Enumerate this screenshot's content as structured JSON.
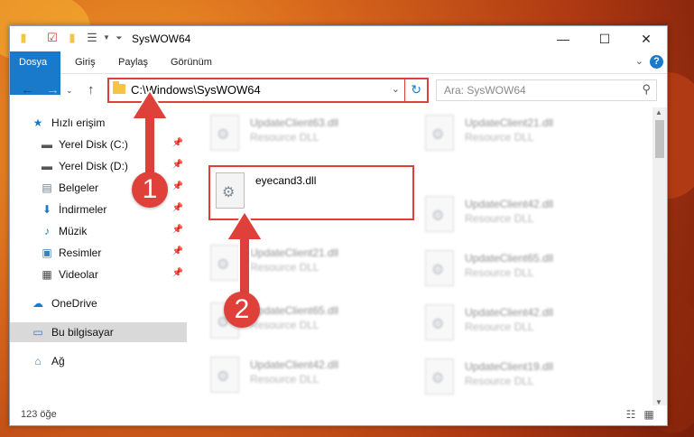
{
  "window": {
    "title": "SysWOW64",
    "controls": {
      "minimize": "—",
      "maximize": "☐",
      "close": "✕"
    }
  },
  "ribbon": {
    "tabs": [
      "Dosya",
      "Giriş",
      "Paylaş",
      "Görünüm"
    ],
    "help": "?"
  },
  "address": {
    "path": "C:\\Windows\\SysWOW64",
    "search_placeholder": "Ara: SysWOW64"
  },
  "sidebar": {
    "quick_access": "Hızlı erişim",
    "items": [
      {
        "label": "Yerel Disk (C:)",
        "icon": "drive-icon"
      },
      {
        "label": "Yerel Disk (D:)",
        "icon": "drive-icon"
      },
      {
        "label": "Belgeler",
        "icon": "documents-icon"
      },
      {
        "label": "İndirmeler",
        "icon": "downloads-icon"
      },
      {
        "label": "Müzik",
        "icon": "music-icon"
      },
      {
        "label": "Resimler",
        "icon": "pictures-icon"
      },
      {
        "label": "Videolar",
        "icon": "videos-icon"
      }
    ],
    "onedrive": "OneDrive",
    "this_pc": "Bu bilgisayar",
    "network": "Ağ"
  },
  "files": {
    "highlighted": {
      "name": "eyecand3.dll"
    },
    "left_column": [
      {
        "name": "UpdateClient63.dll",
        "type": "Resource DLL"
      },
      {
        "name": "UpdateClient21.dll",
        "type": "Resource DLL"
      },
      {
        "name": "UpdateClient65.dll",
        "type": "Resource DLL"
      },
      {
        "name": "UpdateClient42.dll",
        "type": "Resource DLL"
      }
    ],
    "right_column": [
      {
        "name": "UpdateClient21.dll",
        "type": "Resource DLL"
      },
      {
        "name": "UpdateClient42.dll",
        "type": "Resource DLL"
      },
      {
        "name": "UpdateClient65.dll",
        "type": "Resource DLL"
      },
      {
        "name": "UpdateClient42.dll",
        "type": "Resource DLL"
      },
      {
        "name": "UpdateClient19.dll",
        "type": "Resource DLL"
      }
    ]
  },
  "status": {
    "count": "123 öğe"
  },
  "annotations": {
    "step1": "1",
    "step2": "2"
  },
  "colors": {
    "accent": "#1979ca",
    "highlight": "#e0403a"
  }
}
